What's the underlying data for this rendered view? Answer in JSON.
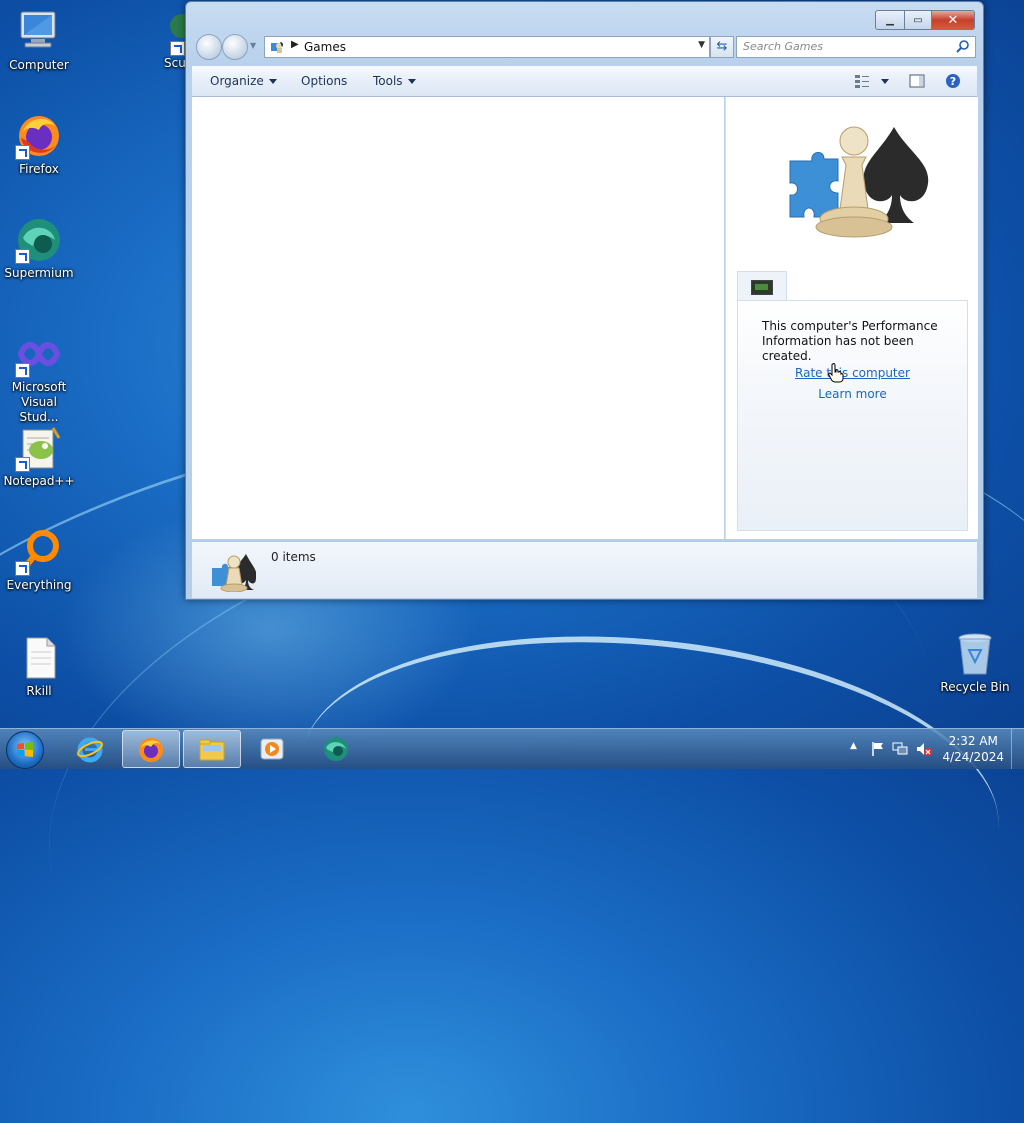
{
  "desktop": {
    "icons": [
      {
        "label": "Computer"
      },
      {
        "label": "Scu"
      },
      {
        "label": "Firefox"
      },
      {
        "label": "Supermium"
      },
      {
        "label": "Microsoft Visual Stud..."
      },
      {
        "label": "Notepad++"
      },
      {
        "label": "Everything"
      },
      {
        "label": "Rkill"
      },
      {
        "label": "Recycle Bin"
      }
    ]
  },
  "window": {
    "address": {
      "path": "Games"
    },
    "search": {
      "placeholder": "Search Games"
    },
    "toolbar": {
      "organize": "Organize",
      "options": "Options",
      "tools": "Tools"
    },
    "details": {
      "perf_text": "This computer's Performance Information has not been created.",
      "rate_link": "Rate this computer",
      "learn_link": "Learn more"
    },
    "status": {
      "count": "0 items"
    }
  },
  "taskbar": {
    "time": "2:32 AM",
    "date": "4/24/2024"
  },
  "colors": {
    "link": "#1a67c2",
    "close_button": "#c7402c",
    "desktop_bg": "#1a6cc4"
  }
}
